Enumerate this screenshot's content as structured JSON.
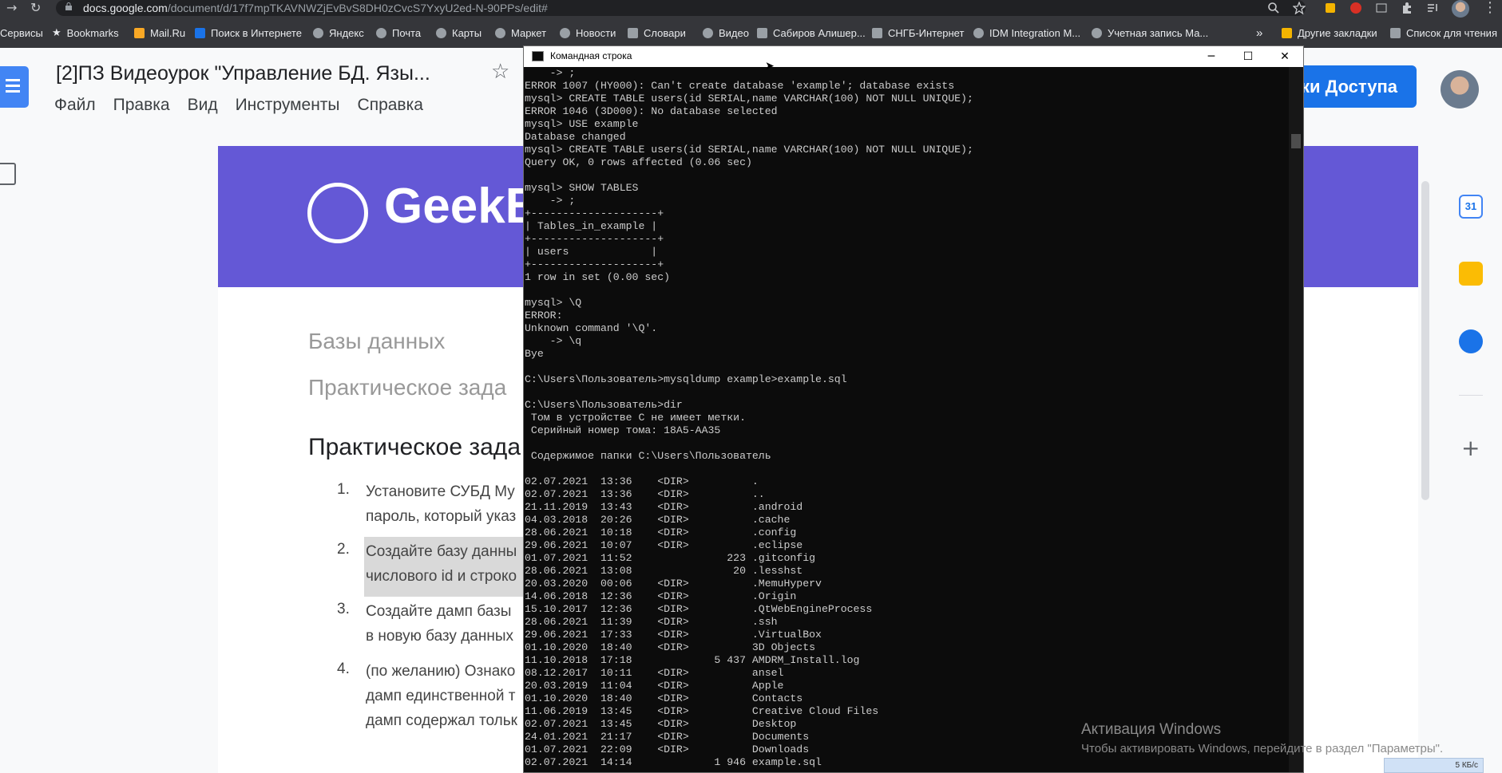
{
  "browser": {
    "url_domain": "docs.google.com",
    "url_path": "/document/d/17f7mpTKAVNWZjEvBvS8DH0zCvcS7YxyU2ed-N-90PPs/edit#",
    "bookmarks": [
      "Сервисы",
      "Bookmarks",
      "Mail.Ru",
      "Поиск в Интернете",
      "Яндекс",
      "Почта",
      "Карты",
      "Маркет",
      "Новости",
      "Словари",
      "Видео",
      "Сабиров Алишер...",
      "СНГБ-Интернет",
      "IDM Integration M...",
      "Учетная запись Ма..."
    ],
    "overflow": "»",
    "other_bookmarks": "Другие закладки",
    "reading_list": "Список для чтения"
  },
  "docs": {
    "title": "[2]ПЗ Видеоурок \"Управление БД. Язы...",
    "menu": [
      "Файл",
      "Правка",
      "Вид",
      "Инструменты",
      "Справка"
    ],
    "access_button": "ки Доступа",
    "banner_text": "GeekB",
    "heading1": "Базы данных",
    "heading2": "Практическое зада",
    "heading3": "Практическое зада",
    "list": [
      {
        "num": "1.",
        "lines": [
          "Установите СУБД Му",
          "пароль, который указ"
        ]
      },
      {
        "num": "2.",
        "lines": [
          "Создайте базу данны",
          "числового id и строко"
        ]
      },
      {
        "num": "3.",
        "lines": [
          "Создайте дамп базы",
          "в новую базу данных"
        ]
      },
      {
        "num": "4.",
        "lines": [
          "(по желанию) Ознако",
          "дамп единственной т",
          "дамп содержал тольк"
        ]
      }
    ]
  },
  "cmd": {
    "title": "Командная строка",
    "lines": [
      "    -> ;",
      "ERROR 1007 (HY000): Can't create database 'example'; database exists",
      "mysql> CREATE TABLE users(id SERIAL,name VARCHAR(100) NOT NULL UNIQUE);",
      "ERROR 1046 (3D000): No database selected",
      "mysql> USE example",
      "Database changed",
      "mysql> CREATE TABLE users(id SERIAL,name VARCHAR(100) NOT NULL UNIQUE);",
      "Query OK, 0 rows affected (0.06 sec)",
      "",
      "mysql> SHOW TABLES",
      "    -> ;",
      "+--------------------+",
      "| Tables_in_example |",
      "+--------------------+",
      "| users             |",
      "+--------------------+",
      "1 row in set (0.00 sec)",
      "",
      "mysql> \\Q",
      "ERROR:",
      "Unknown command '\\Q'.",
      "    -> \\q",
      "Bye",
      "",
      "C:\\Users\\Пользователь>mysqldump example>example.sql",
      "",
      "C:\\Users\\Пользователь>dir",
      " Том в устройстве C не имеет метки.",
      " Серийный номер тома: 18A5-AA35",
      "",
      " Содержимое папки C:\\Users\\Пользователь",
      "",
      "02.07.2021  13:36    <DIR>          .",
      "02.07.2021  13:36    <DIR>          ..",
      "21.11.2019  13:43    <DIR>          .android",
      "04.03.2018  20:26    <DIR>          .cache",
      "28.06.2021  10:18    <DIR>          .config",
      "29.06.2021  10:07    <DIR>          .eclipse",
      "01.07.2021  11:52               223 .gitconfig",
      "28.06.2021  13:08                20 .lesshst",
      "20.03.2020  00:06    <DIR>          .MemuHyperv",
      "14.06.2018  12:36    <DIR>          .Origin",
      "15.10.2017  12:36    <DIR>          .QtWebEngineProcess",
      "28.06.2021  11:39    <DIR>          .ssh",
      "29.06.2021  17:33    <DIR>          .VirtualBox",
      "01.10.2020  18:40    <DIR>          3D Objects",
      "11.10.2018  17:18             5 437 AMDRM_Install.log",
      "08.12.2017  10:11    <DIR>          ansel",
      "20.03.2019  11:04    <DIR>          Apple",
      "01.10.2020  18:40    <DIR>          Contacts",
      "11.06.2019  13:45    <DIR>          Creative Cloud Files",
      "02.07.2021  13:45    <DIR>          Desktop",
      "24.01.2021  21:17    <DIR>          Documents",
      "01.07.2021  22:09    <DIR>          Downloads",
      "02.07.2021  14:14             1 946 example.sql"
    ]
  },
  "activation": {
    "title": "Активация Windows",
    "subtitle": "Чтобы активировать Windows, перейдите в раздел \"Параметры\"."
  },
  "tray": "5 КБ/с"
}
